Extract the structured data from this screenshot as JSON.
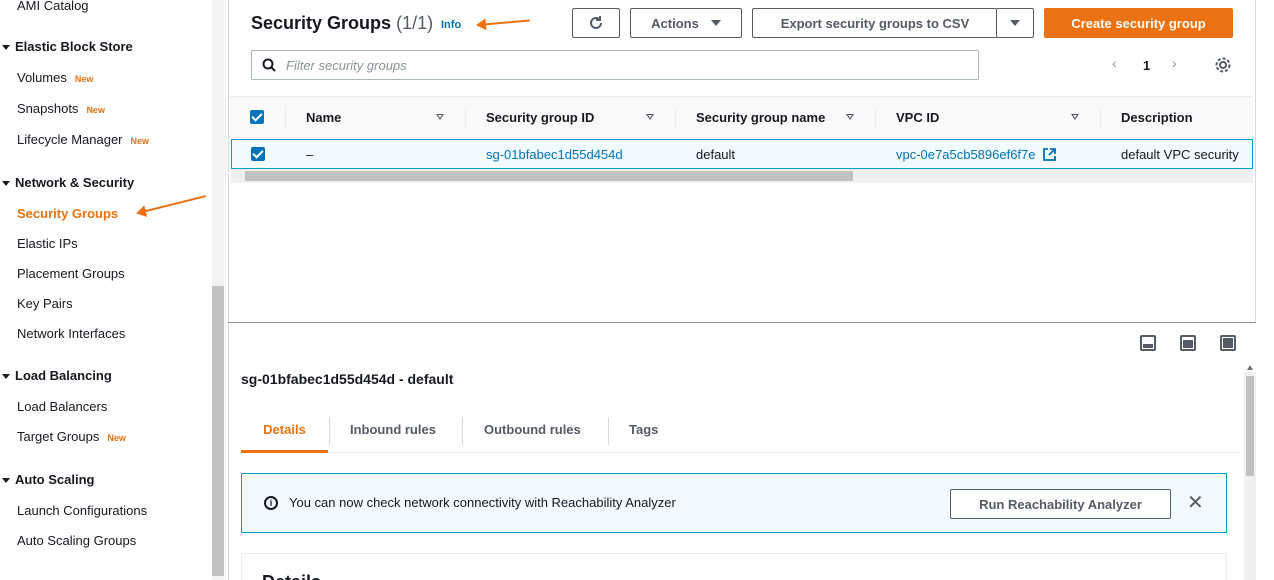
{
  "sidebar": {
    "top_item": "AMI Catalog",
    "sections": [
      {
        "title": "Elastic Block Store",
        "items": [
          {
            "label": "Volumes",
            "badge": "New"
          },
          {
            "label": "Snapshots",
            "badge": "New"
          },
          {
            "label": "Lifecycle Manager",
            "badge": "New"
          }
        ]
      },
      {
        "title": "Network & Security",
        "items": [
          {
            "label": "Security Groups",
            "badge": ""
          },
          {
            "label": "Elastic IPs",
            "badge": ""
          },
          {
            "label": "Placement Groups",
            "badge": ""
          },
          {
            "label": "Key Pairs",
            "badge": ""
          },
          {
            "label": "Network Interfaces",
            "badge": ""
          }
        ]
      },
      {
        "title": "Load Balancing",
        "items": [
          {
            "label": "Load Balancers",
            "badge": ""
          },
          {
            "label": "Target Groups",
            "badge": "New"
          }
        ]
      },
      {
        "title": "Auto Scaling",
        "items": [
          {
            "label": "Launch Configurations",
            "badge": ""
          },
          {
            "label": "Auto Scaling Groups",
            "badge": ""
          }
        ]
      }
    ]
  },
  "header": {
    "title": "Security Groups",
    "count": "(1/1)",
    "info": "Info",
    "actions_label": "Actions",
    "export_label": "Export security groups to CSV",
    "create_label": "Create security group"
  },
  "search": {
    "placeholder": "Filter security groups"
  },
  "pagination": {
    "current_page": "1"
  },
  "table": {
    "columns": [
      "Name",
      "Security group ID",
      "Security group name",
      "VPC ID",
      "Description"
    ],
    "rows": [
      {
        "name": "–",
        "sg_id": "sg-01bfabec1d55d454d",
        "sg_name": "default",
        "vpc_id": "vpc-0e7a5cb5896ef6f7e",
        "description": "default VPC security"
      }
    ]
  },
  "details": {
    "title": "sg-01bfabec1d55d454d - default",
    "tabs": [
      "Details",
      "Inbound rules",
      "Outbound rules",
      "Tags"
    ],
    "alert_text": "You can now check network connectivity with Reachability Analyzer",
    "alert_button": "Run Reachability Analyzer",
    "card_title": "Details"
  },
  "colors": {
    "accent": "#ec7211",
    "link": "#0073bb",
    "info_border": "#00a1c9"
  }
}
